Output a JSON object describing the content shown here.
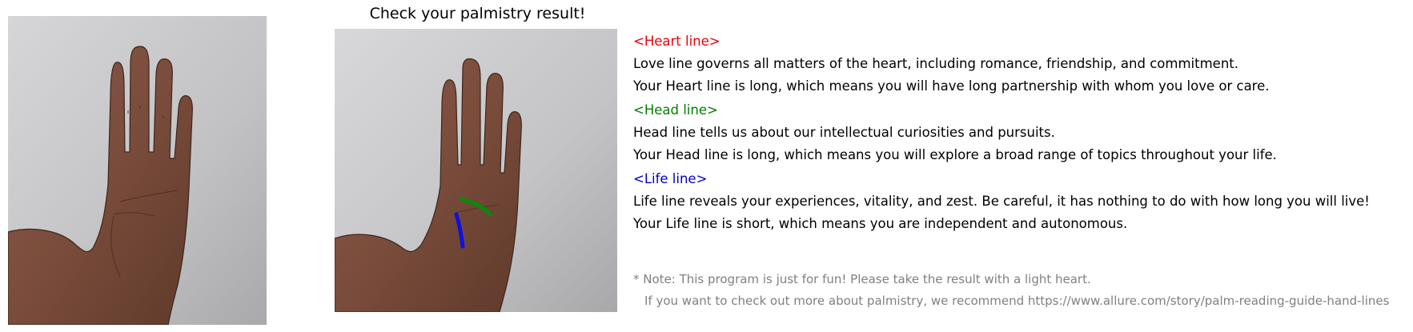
{
  "result": {
    "title": "Check your palmistry result!"
  },
  "colors": {
    "heart": "#e8000b",
    "head": "#008000",
    "life": "#0000cc",
    "note": "#808080"
  },
  "sections": [
    {
      "heading": "<Heart line>",
      "description": "Love line governs all matters of the heart, including romance, friendship, and commitment.",
      "result": "Your Heart line is long, which means you will have long partnership with whom you love or care."
    },
    {
      "heading": "<Head line>",
      "description": "Head line tells us about our intellectual curiosities and pursuits.",
      "result": "Your Head line is long, which means you will explore a broad range of topics throughout your life."
    },
    {
      "heading": "<Life line>",
      "description": "Life line reveals your experiences, vitality, and zest. Be careful, it has nothing to do with how long you will live!",
      "result": "Your Life line is short, which means you are independent and autonomous."
    }
  ],
  "note": {
    "line1": "* Note: This program is just for fun! Please take the result with a light heart.",
    "line2": "If you want to check out more about palmistry, we recommend https://www.allure.com/story/palm-reading-guide-hand-lines"
  }
}
